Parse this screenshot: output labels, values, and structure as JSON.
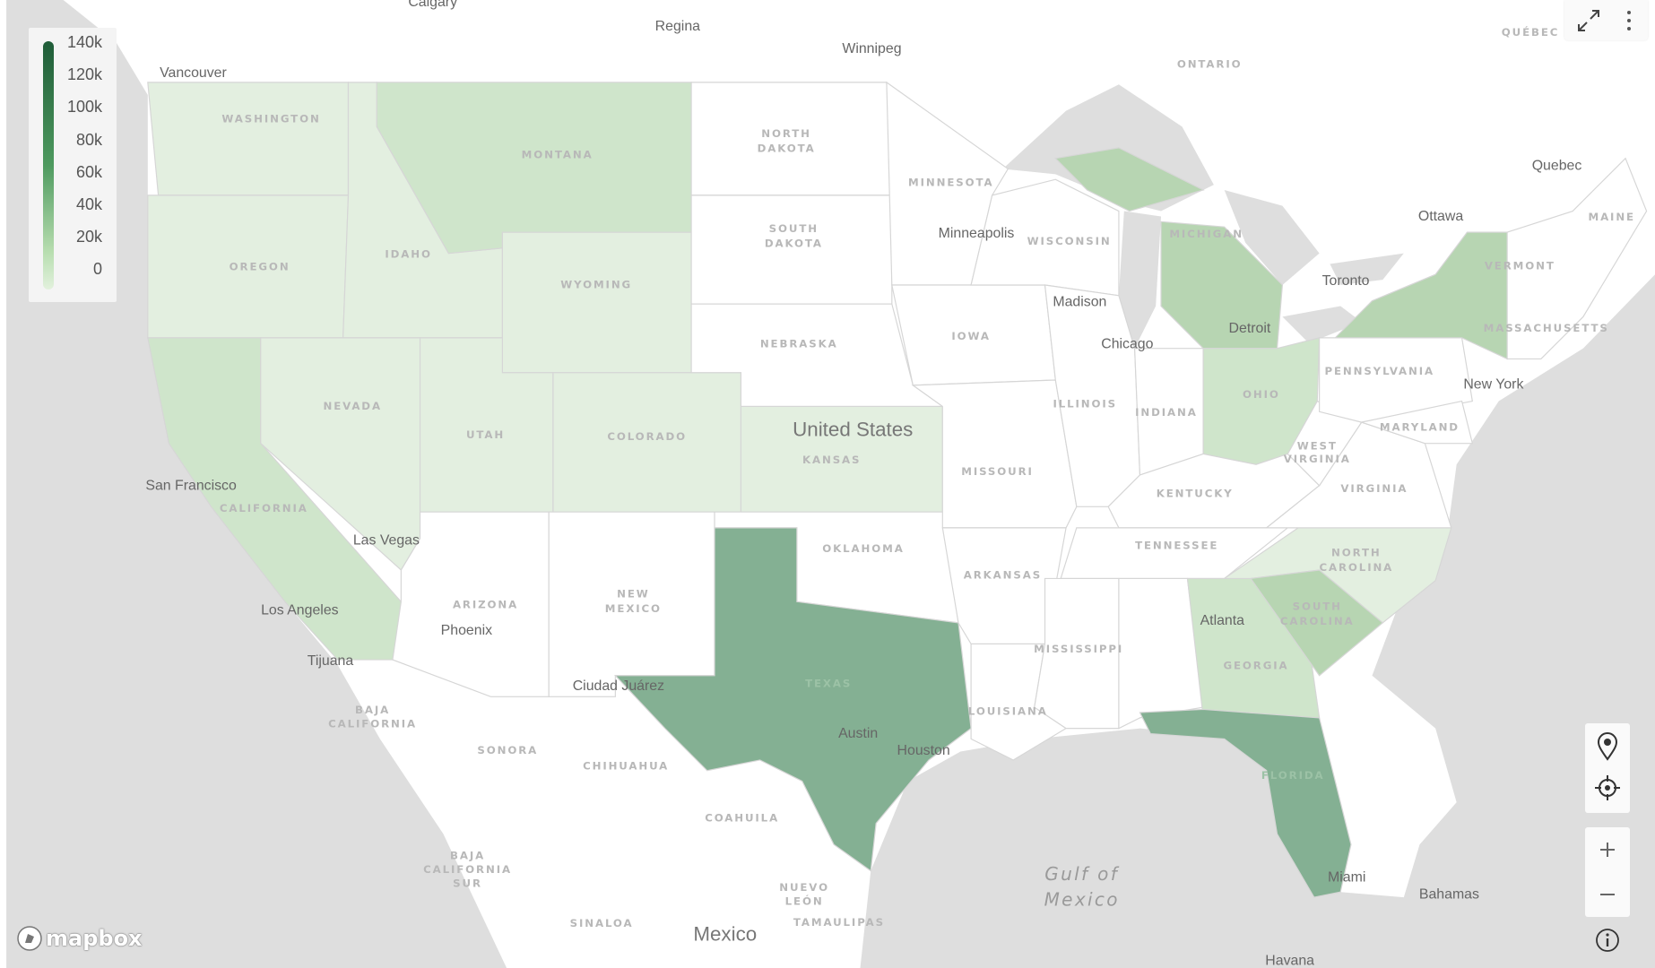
{
  "legend": {
    "ticks": [
      "140k",
      "120k",
      "100k",
      "80k",
      "60k",
      "40k",
      "20k",
      "0"
    ],
    "colors": {
      "high": "#1f5c38",
      "low": "#e2f1dd"
    }
  },
  "colors": {
    "ocean": "#dedede",
    "land": "#ffffff",
    "lakes": "#d9d9d9",
    "tier_high": "#84b093",
    "tier_mid": "#b7d5b2",
    "tier_low": "#cfe5cb",
    "tier_min": "#e3efe0",
    "no_data": "#ffffff"
  },
  "states": {
    "washington": "WASHINGTON",
    "montana": "MONTANA",
    "oregon": "OREGON",
    "idaho": "IDAHO",
    "wyoming": "WYOMING",
    "north_dakota": [
      "NORTH",
      "DAKOTA"
    ],
    "south_dakota": [
      "SOUTH",
      "DAKOTA"
    ],
    "minnesota": "MINNESOTA",
    "wisconsin": "WISCONSIN",
    "michigan": "MICHIGAN",
    "nebraska": "NEBRASKA",
    "iowa": "IOWA",
    "nevada": "NEVADA",
    "utah": "UTAH",
    "colorado": "COLORADO",
    "kansas": "KANSAS",
    "missouri": "MISSOURI",
    "illinois": "ILLINOIS",
    "indiana": "INDIANA",
    "ohio": "OHIO",
    "pennsylvania": "PENNSYLVANIA",
    "west_virginia": [
      "WEST",
      "VIRGINIA"
    ],
    "maryland": "MARYLAND",
    "virginia": "VIRGINIA",
    "kentucky": "KENTUCKY",
    "tennessee": "TENNESSEE",
    "north_carolina": [
      "NORTH",
      "CAROLINA"
    ],
    "south_carolina": [
      "SOUTH",
      "CAROLINA"
    ],
    "georgia": "GEORGIA",
    "california": "CALIFORNIA",
    "arizona": "ARIZONA",
    "new_mexico": [
      "NEW",
      "MEXICO"
    ],
    "oklahoma": "OKLAHOMA",
    "arkansas": "ARKANSAS",
    "texas": "TEXAS",
    "mississippi": "MISSISSIPPI",
    "louisiana": "LOUISIANA",
    "florida": "FLORIDA",
    "vermont": "VERMONT",
    "massachusetts": "MASSACHUSETTS",
    "maine": "MAINE"
  },
  "regions": {
    "ontario": "ONTARIO",
    "quebec": "QUÉBEC",
    "sonora": "SONORA",
    "chihuahua": "CHIHUAHUA",
    "coahuila": "COAHUILA",
    "baja_california": [
      "BAJA",
      "CALIFORNIA"
    ],
    "baja_california_sur": [
      "BAJA",
      "CALIFORNIA",
      "SUR"
    ],
    "nuevo_leon": [
      "NUEVO",
      "LEÓN"
    ],
    "tamaulipas": "TAMAULIPAS",
    "sinaloa": "SINALOA"
  },
  "cities": {
    "calgary": "Calgary",
    "regina": "Regina",
    "winnipeg": "Winnipeg",
    "vancouver": "Vancouver",
    "minneapolis": "Minneapolis",
    "madison": "Madison",
    "chicago": "Chicago",
    "detroit": "Detroit",
    "toronto": "Toronto",
    "ottawa": "Ottawa",
    "quebec": "Quebec",
    "new_york": "New York",
    "san_francisco": "San Francisco",
    "las_vegas": "Las Vegas",
    "los_angeles": "Los Angeles",
    "phoenix": "Phoenix",
    "tijuana": "Tijuana",
    "ciudad_juarez": "Ciudad Juárez",
    "austin": "Austin",
    "houston": "Houston",
    "atlanta": "Atlanta",
    "miami": "Miami",
    "bahamas": "Bahamas",
    "havana": "Havana"
  },
  "countries": {
    "united_states": "United States",
    "mexico": "Mexico"
  },
  "water": {
    "gulf": [
      "Gulf of",
      "Mexico"
    ]
  },
  "attribution": {
    "logo": "mapbox"
  },
  "controls": {
    "icons": [
      "expand-icon",
      "more-vertical-icon",
      "map-pin-icon",
      "locate-icon",
      "zoom-in-icon",
      "zoom-out-icon",
      "info-icon"
    ]
  }
}
